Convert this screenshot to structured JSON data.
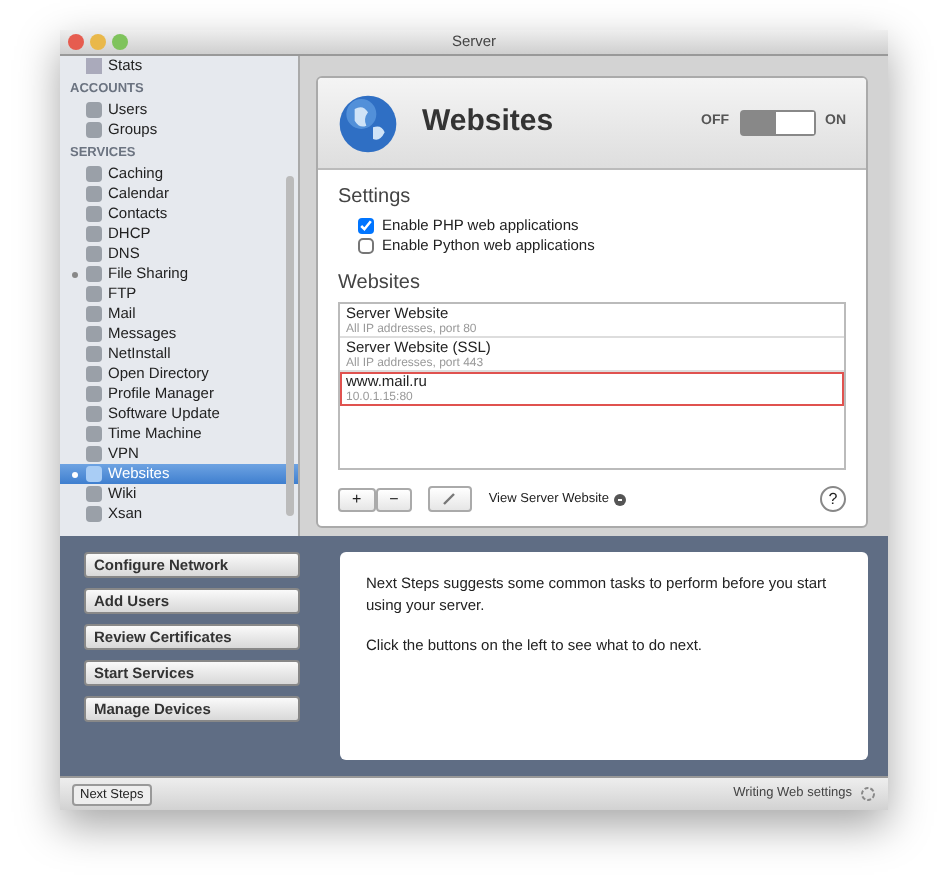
{
  "window": {
    "title": "Server"
  },
  "sidebar": {
    "partial_item": "Stats",
    "sections": [
      {
        "header": "ACCOUNTS",
        "items": [
          {
            "label": "Users",
            "dot": false,
            "selected": false
          },
          {
            "label": "Groups",
            "dot": false,
            "selected": false
          }
        ]
      },
      {
        "header": "SERVICES",
        "items": [
          {
            "label": "Caching",
            "dot": false,
            "selected": false
          },
          {
            "label": "Calendar",
            "dot": false,
            "selected": false
          },
          {
            "label": "Contacts",
            "dot": false,
            "selected": false
          },
          {
            "label": "DHCP",
            "dot": false,
            "selected": false
          },
          {
            "label": "DNS",
            "dot": false,
            "selected": false
          },
          {
            "label": "File Sharing",
            "dot": true,
            "selected": false
          },
          {
            "label": "FTP",
            "dot": false,
            "selected": false
          },
          {
            "label": "Mail",
            "dot": false,
            "selected": false
          },
          {
            "label": "Messages",
            "dot": false,
            "selected": false
          },
          {
            "label": "NetInstall",
            "dot": false,
            "selected": false
          },
          {
            "label": "Open Directory",
            "dot": false,
            "selected": false
          },
          {
            "label": "Profile Manager",
            "dot": false,
            "selected": false
          },
          {
            "label": "Software Update",
            "dot": false,
            "selected": false
          },
          {
            "label": "Time Machine",
            "dot": false,
            "selected": false
          },
          {
            "label": "VPN",
            "dot": false,
            "selected": false
          },
          {
            "label": "Websites",
            "dot": true,
            "selected": true
          },
          {
            "label": "Wiki",
            "dot": false,
            "selected": false
          },
          {
            "label": "Xsan",
            "dot": false,
            "selected": false
          }
        ]
      }
    ]
  },
  "service": {
    "title": "Websites",
    "toggle": {
      "off_label": "OFF",
      "on_label": "ON",
      "on": true
    },
    "settings_heading": "Settings",
    "settings": [
      {
        "label": "Enable PHP web applications",
        "checked": true
      },
      {
        "label": "Enable Python web applications",
        "checked": false
      }
    ],
    "websites_heading": "Websites",
    "websites": [
      {
        "name": "Server Website",
        "detail": "All IP addresses, port 80",
        "highlighted": false
      },
      {
        "name": "Server Website (SSL)",
        "detail": "All IP addresses, port 443",
        "highlighted": false
      },
      {
        "name": "www.mail.ru",
        "detail": "10.0.1.15:80",
        "highlighted": true
      }
    ],
    "add_button": "+",
    "remove_button": "−",
    "view_link": "View Server Website",
    "help_button": "?"
  },
  "next_steps": {
    "buttons": [
      "Configure Network",
      "Add Users",
      "Review Certificates",
      "Start Services",
      "Manage Devices"
    ],
    "paragraphs": [
      "Next Steps suggests some common tasks to perform before you start using your server.",
      "Click the buttons on the left to see what to do next."
    ]
  },
  "status_bar": {
    "next_steps_button": "Next Steps",
    "status": "Writing Web settings"
  }
}
